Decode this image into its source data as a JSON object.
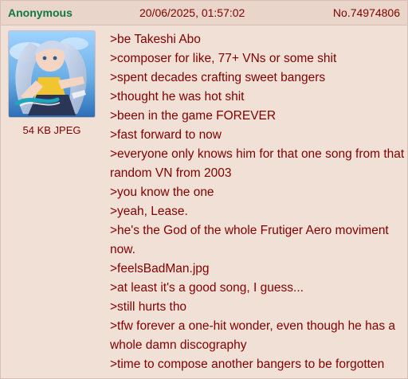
{
  "post": {
    "name": "Anonymous",
    "date": "20/06/2025, 01:57:02",
    "number": "No.74974806",
    "file_info": "54 KB JPEG",
    "thumbnail_icon": "anime-girl-thumbnail",
    "lines": [
      ">be Takeshi Abo",
      ">composer for like, 77+ VNs or some shit",
      ">spent decades crafting sweet bangers",
      ">thought he was hot shit",
      ">been in the game FOREVER",
      ">fast forward to now",
      ">everyone only knows him for that one song from that random VN from 2003",
      ">you know the one",
      ">yeah, Lease.",
      ">he's the God of the whole Frutiger Aero moviment now.",
      ">feelsBadMan.jpg",
      ">at least it's a good song, I guess...",
      ">still hurts tho",
      ">tfw forever a one-hit wonder, even though he has a whole damn discography",
      ">time to compose another bangers to be forgotten"
    ]
  },
  "colors": {
    "background": "#f0e0d6",
    "header": "#ead5cb",
    "name": "#117743",
    "text": "#800000",
    "border": "#d9bfb7"
  }
}
